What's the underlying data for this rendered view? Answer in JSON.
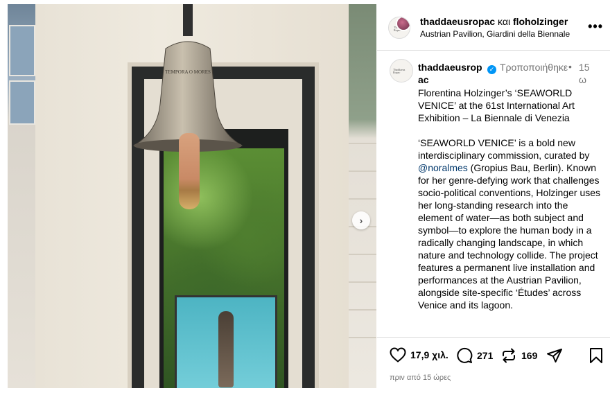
{
  "post": {
    "header": {
      "user1": "thaddaeusropac",
      "connector": " και ",
      "user2": "floholzinger",
      "location": "Austrian Pavilion, Giardini della Biennale",
      "more_icon": "more-icon",
      "avatar_mini_text": "Thaddaeus Ropac"
    },
    "caption": {
      "username": "thaddaeusropac",
      "edited": "Τροποποιήθηκε",
      "separator": "•",
      "time": "15 ω",
      "line1": "Florentina Holzinger’s ‘SEAWORLD VENICE’ at the 61st International Art Exhibition – La Biennale di Venezia",
      "para2_before": "‘SEAWORLD VENICE’ is a bold new interdisciplinary commission, curated by ",
      "mention": "@noralmes",
      "para2_after": " (Gropius Bau, Berlin). Known for her genre-defying work that challenges socio-political conventions, Holzinger uses her long-standing research into the element of water—as both subject and symbol—to explore the human body in a radically changing landscape, in which nature and technology collide. The project features a permanent live installation and performances at the Austrian Pavilion, alongside site-specific ‘Études’ across Venice and its lagoon."
    },
    "actions": {
      "likes": "17,9 χιλ.",
      "comments": "271",
      "reposts": "169",
      "timestamp": "πριν από 15 ώρες"
    },
    "media": {
      "bell_inscription": "TEMPORA O MORES",
      "next_arrow": "›"
    }
  },
  "colors": {
    "link": "#00376b",
    "verified": "#0095f6",
    "muted": "#737373",
    "divider": "#dbdbdb"
  }
}
